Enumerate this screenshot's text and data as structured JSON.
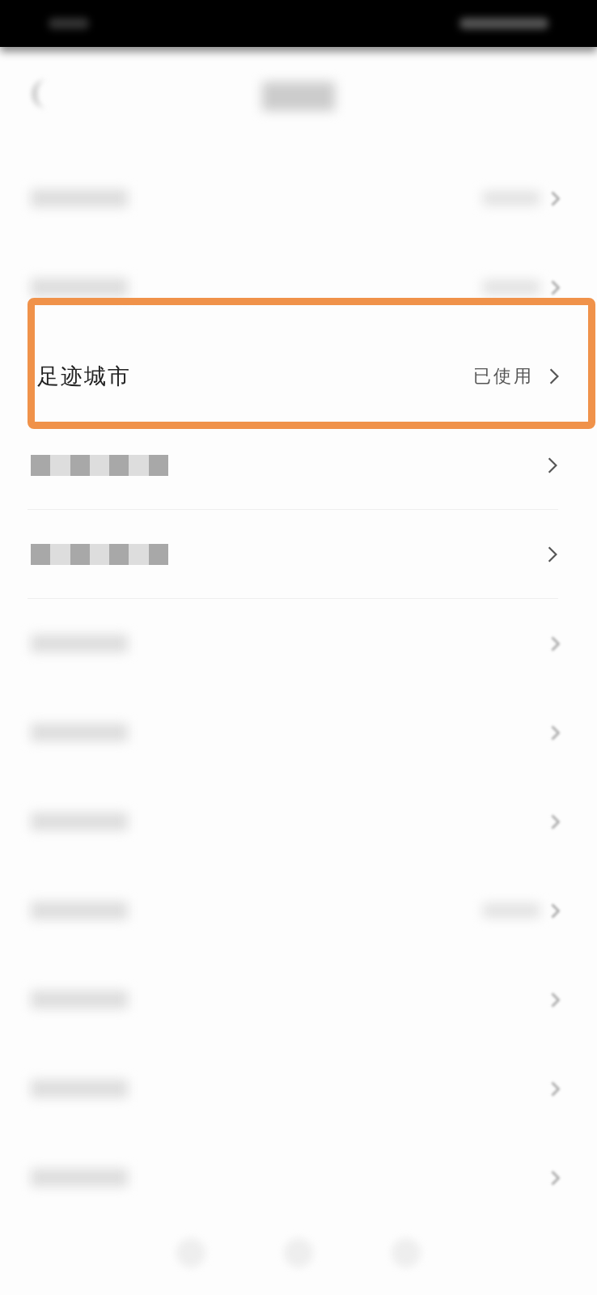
{
  "rows": [
    {
      "kind": "blurred",
      "value_shown": true
    },
    {
      "kind": "blurred",
      "value_shown": true
    },
    {
      "kind": "highlighted",
      "label": "足迹城市",
      "value": "已使用"
    },
    {
      "kind": "pixelated"
    },
    {
      "kind": "pixelated"
    },
    {
      "kind": "blurred",
      "value_shown": false
    },
    {
      "kind": "blurred",
      "value_shown": false
    },
    {
      "kind": "blurred",
      "value_shown": false
    },
    {
      "kind": "blurred",
      "value_shown": true
    },
    {
      "kind": "blurred",
      "value_shown": false
    },
    {
      "kind": "blurred",
      "value_shown": false
    },
    {
      "kind": "blurred",
      "value_shown": false
    }
  ]
}
